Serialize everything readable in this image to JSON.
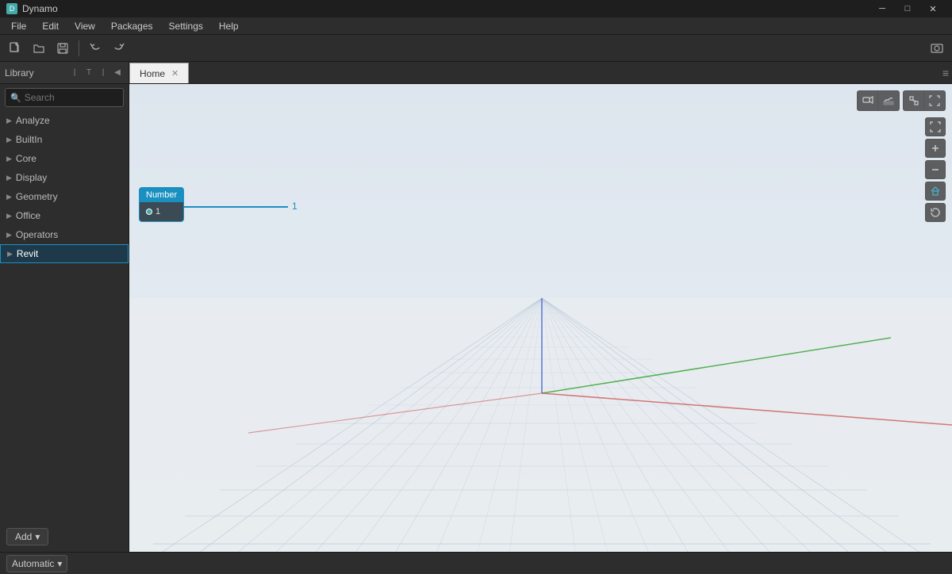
{
  "app": {
    "title": "Dynamo",
    "icon": "D"
  },
  "titlebar": {
    "minimize": "─",
    "maximize": "□",
    "close": "✕"
  },
  "menubar": {
    "items": [
      "File",
      "Edit",
      "View",
      "Packages",
      "Settings",
      "Help"
    ]
  },
  "toolbar": {
    "buttons": [
      "📄",
      "💾",
      "⬜",
      "↩",
      "↪"
    ]
  },
  "sidebar": {
    "title": "Library",
    "controls": [
      "|",
      "T",
      "|",
      "◀"
    ],
    "search_placeholder": "Search",
    "items": [
      {
        "id": "analyze",
        "label": "Analyze"
      },
      {
        "id": "builtin",
        "label": "BuiltIn"
      },
      {
        "id": "core",
        "label": "Core"
      },
      {
        "id": "display",
        "label": "Display"
      },
      {
        "id": "geometry",
        "label": "Geometry"
      },
      {
        "id": "office",
        "label": "Office"
      },
      {
        "id": "operators",
        "label": "Operators"
      },
      {
        "id": "revit",
        "label": "Revit"
      }
    ],
    "add_button": "Add"
  },
  "tabs": [
    {
      "id": "home",
      "label": "Home",
      "active": true
    }
  ],
  "tab_menu_icon": "≡",
  "viewport": {
    "node": {
      "label": "1",
      "title": "Number",
      "value": "1"
    }
  },
  "viewport_controls_top": [
    {
      "id": "camera-3d",
      "icon": "⛶"
    },
    {
      "id": "background",
      "icon": "☁"
    }
  ],
  "viewport_controls_top2": [
    {
      "id": "frame",
      "icon": "⛶"
    },
    {
      "id": "fit",
      "icon": "⊕"
    }
  ],
  "viewport_controls_right": [
    {
      "id": "fullscreen",
      "icon": "⛶"
    },
    {
      "id": "zoom-in",
      "icon": "+"
    },
    {
      "id": "zoom-out",
      "icon": "−"
    },
    {
      "id": "home-view",
      "icon": "⌂",
      "blue": true
    },
    {
      "id": "reset",
      "icon": "↺"
    }
  ],
  "statusbar": {
    "run_mode": "Automatic",
    "run_mode_arrow": "▾"
  }
}
